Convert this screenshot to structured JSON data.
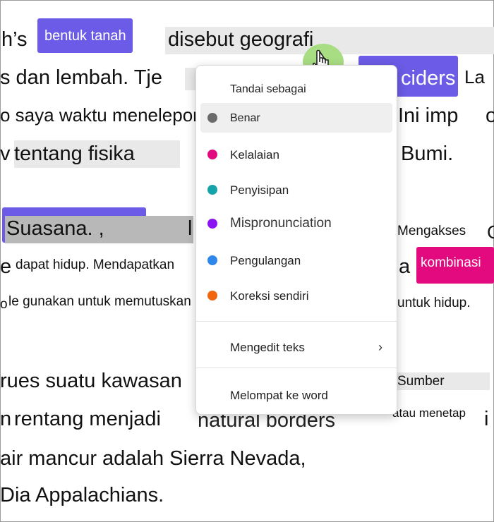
{
  "document": {
    "line1": {
      "a": "h’s",
      "b": "bentuk tanah",
      "c": "disebut geografi"
    },
    "line2": {
      "a": "s dan lembah. Tje",
      "b": "ciders",
      "c": "La"
    },
    "line3": {
      "a": "o saya waktu menelepon",
      "b": "Ini imp",
      "c": "o"
    },
    "line4": {
      "a": "v",
      "b": "tentang fisika",
      "c": "Bumi."
    },
    "line5": {
      "a": "Suasana. ,",
      "b": "l",
      "c": "Mengakses",
      "d": "C"
    },
    "line6": {
      "a": "e",
      "b": "dapat hidup. Mendapatkan",
      "c": "a",
      "d": "kombinasi"
    },
    "line7": {
      "a": "o",
      "b": "le gunakan untuk memutuskan",
      "c": "untuk hidup."
    },
    "line8": {
      "a": "rues suatu kawasan",
      "b": "Sumber"
    },
    "line9": {
      "a": "n",
      "b": "rentang menjadi",
      "c": "natural borders",
      "d": "atau menetap",
      "e": "i"
    },
    "line10": {
      "a": "air mancur adalah Sierra Nevada,"
    },
    "line11": {
      "a": "Dia Appalachians."
    }
  },
  "context_menu": {
    "header": "Tandai sebagai",
    "items": [
      {
        "label": "Benar",
        "color": "#6b6b6b",
        "icon": "dot-gray-icon"
      },
      {
        "label": "Kelalaian",
        "color": "#e3097f",
        "icon": "dot-pink-icon"
      },
      {
        "label": "Penyisipan",
        "color": "#13a3a8",
        "icon": "dot-teal-icon"
      },
      {
        "label": "Mispronunciation",
        "color": "#8a14f2",
        "icon": "dot-purple-icon"
      },
      {
        "label": "Pengulangan",
        "color": "#2f86eb",
        "icon": "dot-blue-icon"
      },
      {
        "label": "Koreksi sendiri",
        "color": "#f0650e",
        "icon": "dot-orange-icon"
      }
    ],
    "edit_text": "Mengedit teks",
    "jump_to_word": "Melompat ke word"
  }
}
